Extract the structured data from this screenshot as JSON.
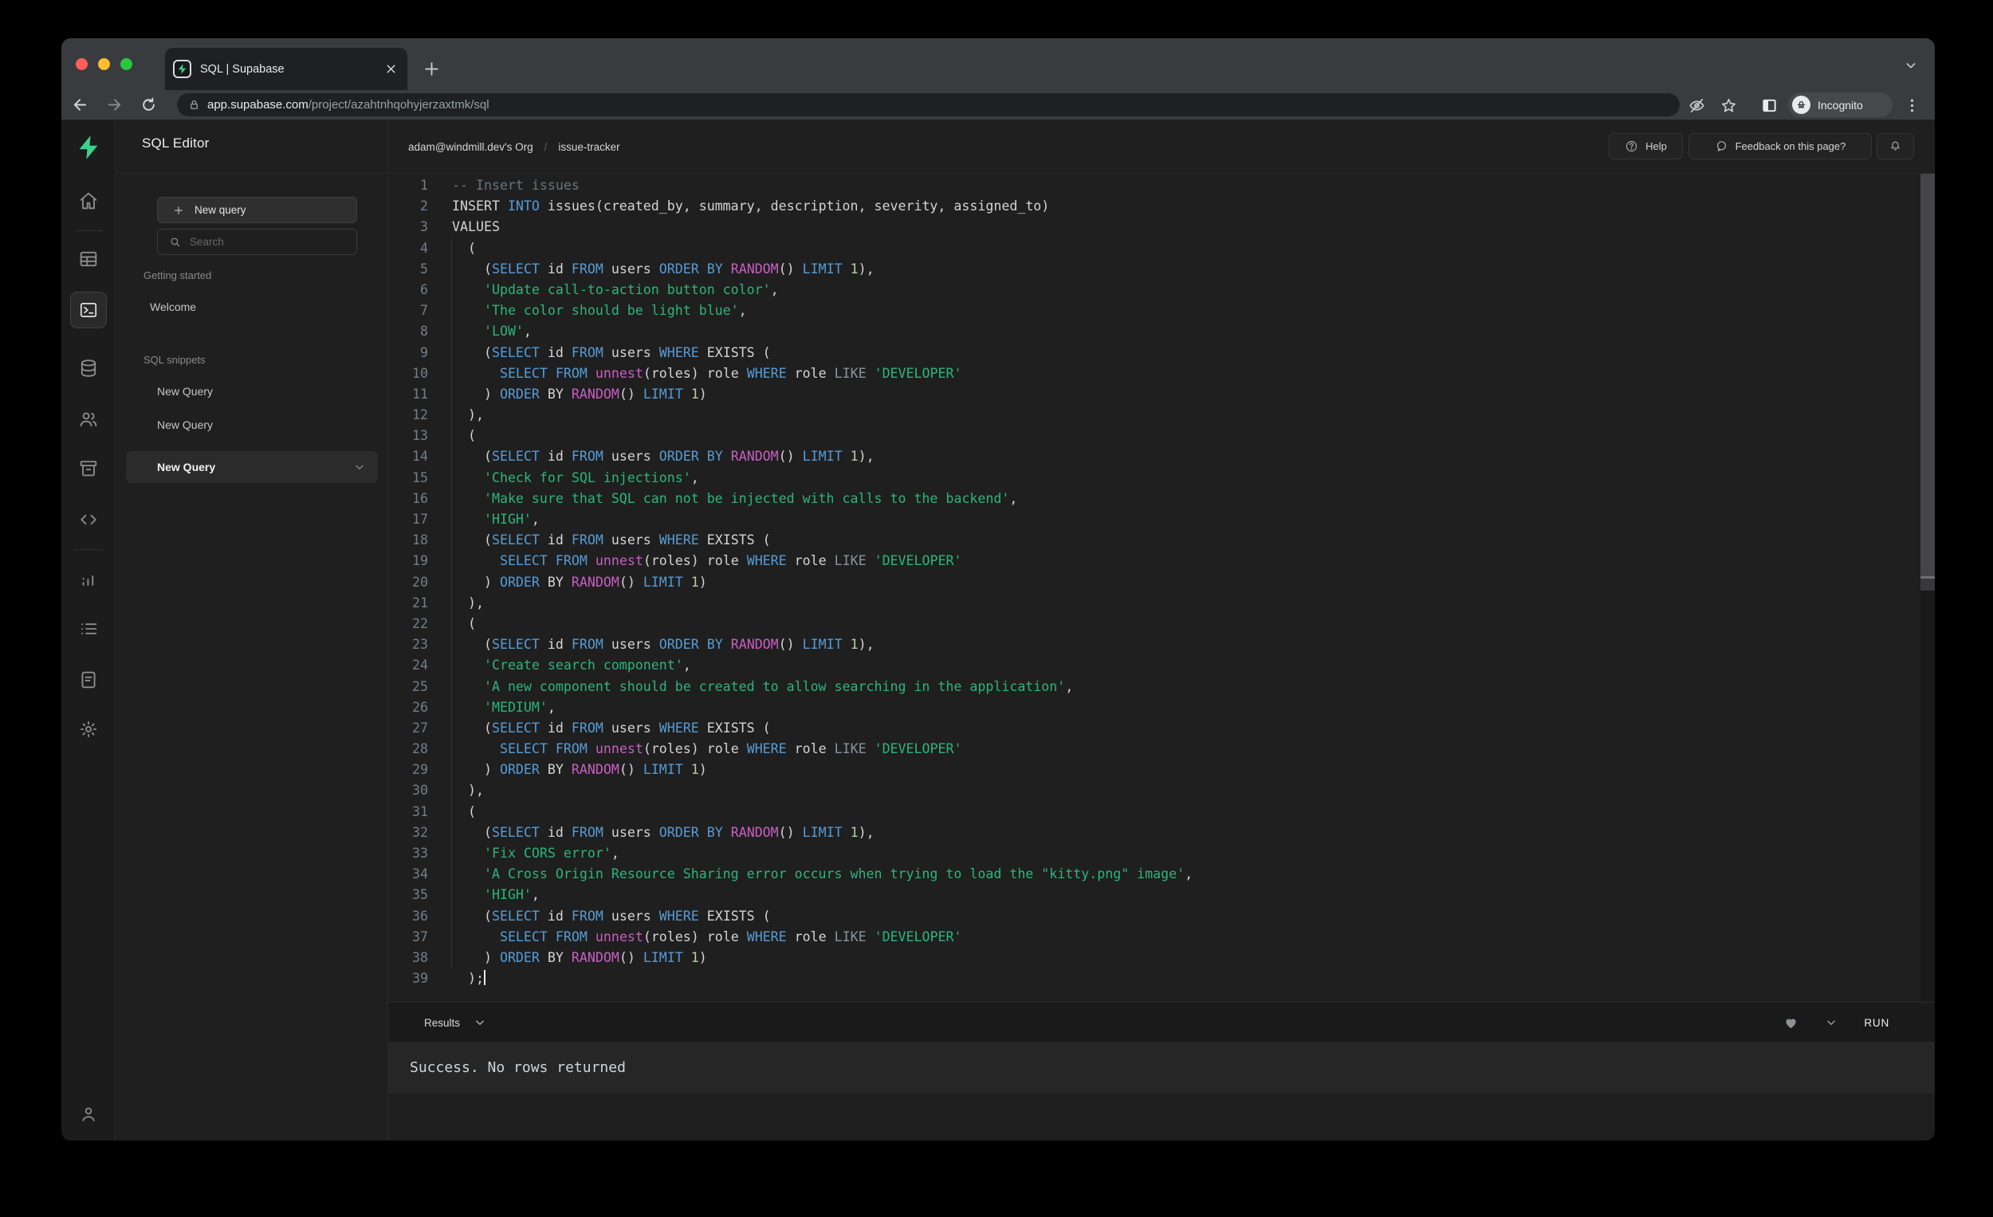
{
  "chrome": {
    "tab_title": "SQL | Supabase",
    "url_host": "app.supabase.com",
    "url_path": "/project/azahtnhqohyjerzaxtmk/sql",
    "incognito_label": "Incognito"
  },
  "rail_items": [
    {
      "icon": "supabase-logo-icon",
      "type": "logo"
    },
    {
      "icon": "home-icon"
    },
    {
      "type": "divider"
    },
    {
      "icon": "table-editor-icon"
    },
    {
      "icon": "sql-editor-icon",
      "selected": true
    },
    {
      "icon": "database-icon"
    },
    {
      "icon": "auth-icon"
    },
    {
      "icon": "storage-icon"
    },
    {
      "icon": "code-icon"
    },
    {
      "type": "divider"
    },
    {
      "icon": "reports-icon"
    },
    {
      "icon": "logs-icon"
    },
    {
      "icon": "docs-icon"
    },
    {
      "icon": "settings-icon"
    },
    {
      "icon": "profile-icon"
    }
  ],
  "sidebar": {
    "title": "SQL Editor",
    "new_query_button": "New query",
    "search_placeholder": "Search",
    "sections": [
      {
        "label": "Getting started",
        "items": [
          {
            "label": "Welcome",
            "style": "welcome"
          }
        ]
      },
      {
        "label": "SQL snippets",
        "items": [
          {
            "label": "New Query"
          },
          {
            "label": "New Query"
          },
          {
            "label": "New Query",
            "selected": true
          }
        ]
      }
    ]
  },
  "header": {
    "org": "adam@windmill.dev's Org",
    "separator": "/",
    "project": "issue-tracker",
    "help_label": "Help",
    "feedback_label": "Feedback on this page?"
  },
  "editor": {
    "syntax_colors": {
      "d": "#D4D4D4",
      "k": "#569CD6",
      "f": "#C95FC3",
      "s": "#2DB47E",
      "c": "#6A737D",
      "n": "#B5CEA8",
      "g": "#8B939E"
    },
    "lines": [
      {
        "segs": [
          [
            "c",
            "-- Insert issues"
          ]
        ]
      },
      {
        "segs": [
          [
            "d",
            "INSERT "
          ],
          [
            "k",
            "INTO"
          ],
          [
            "d",
            " issues(created_by, summary, description, severity, assigned_to)"
          ]
        ]
      },
      {
        "segs": [
          [
            "d",
            "VALUES"
          ]
        ]
      },
      {
        "segs": [
          [
            "d",
            "  ("
          ]
        ]
      },
      {
        "segs": [
          [
            "d",
            "    ("
          ],
          [
            "k",
            "SELECT"
          ],
          [
            "d",
            " id "
          ],
          [
            "k",
            "FROM"
          ],
          [
            "d",
            " users "
          ],
          [
            "k",
            "ORDER"
          ],
          [
            "d",
            " "
          ],
          [
            "k",
            "BY"
          ],
          [
            "d",
            " "
          ],
          [
            "f",
            "RANDOM"
          ],
          [
            "d",
            "() "
          ],
          [
            "k",
            "LIMIT"
          ],
          [
            "d",
            " "
          ],
          [
            "n",
            "1"
          ],
          [
            "d",
            "),"
          ]
        ]
      },
      {
        "segs": [
          [
            "d",
            "    "
          ],
          [
            "s",
            "'Update call-to-action button color'"
          ],
          [
            "d",
            ","
          ]
        ]
      },
      {
        "segs": [
          [
            "d",
            "    "
          ],
          [
            "s",
            "'The color should be light blue'"
          ],
          [
            "d",
            ","
          ]
        ]
      },
      {
        "segs": [
          [
            "d",
            "    "
          ],
          [
            "s",
            "'LOW'"
          ],
          [
            "d",
            ","
          ]
        ]
      },
      {
        "segs": [
          [
            "d",
            "    ("
          ],
          [
            "k",
            "SELECT"
          ],
          [
            "d",
            " id "
          ],
          [
            "k",
            "FROM"
          ],
          [
            "d",
            " users "
          ],
          [
            "k",
            "WHERE"
          ],
          [
            "d",
            " EXISTS ("
          ]
        ]
      },
      {
        "segs": [
          [
            "d",
            "      "
          ],
          [
            "k",
            "SELECT"
          ],
          [
            "d",
            " "
          ],
          [
            "k",
            "FROM"
          ],
          [
            "d",
            " "
          ],
          [
            "f",
            "unnest"
          ],
          [
            "d",
            "(roles) role "
          ],
          [
            "k",
            "WHERE"
          ],
          [
            "d",
            " role "
          ],
          [
            "g",
            "LIKE"
          ],
          [
            "d",
            " "
          ],
          [
            "s",
            "'DEVELOPER'"
          ]
        ]
      },
      {
        "segs": [
          [
            "d",
            "    ) "
          ],
          [
            "k",
            "ORDER"
          ],
          [
            "d",
            " BY "
          ],
          [
            "f",
            "RANDOM"
          ],
          [
            "d",
            "() "
          ],
          [
            "k",
            "LIMIT"
          ],
          [
            "d",
            " "
          ],
          [
            "n",
            "1"
          ],
          [
            "d",
            ")"
          ]
        ]
      },
      {
        "segs": [
          [
            "d",
            "  ),"
          ]
        ]
      },
      {
        "segs": [
          [
            "d",
            "  ("
          ]
        ]
      },
      {
        "segs": [
          [
            "d",
            "    ("
          ],
          [
            "k",
            "SELECT"
          ],
          [
            "d",
            " id "
          ],
          [
            "k",
            "FROM"
          ],
          [
            "d",
            " users "
          ],
          [
            "k",
            "ORDER"
          ],
          [
            "d",
            " "
          ],
          [
            "k",
            "BY"
          ],
          [
            "d",
            " "
          ],
          [
            "f",
            "RANDOM"
          ],
          [
            "d",
            "() "
          ],
          [
            "k",
            "LIMIT"
          ],
          [
            "d",
            " "
          ],
          [
            "n",
            "1"
          ],
          [
            "d",
            "),"
          ]
        ]
      },
      {
        "segs": [
          [
            "d",
            "    "
          ],
          [
            "s",
            "'Check for SQL injections'"
          ],
          [
            "d",
            ","
          ]
        ]
      },
      {
        "segs": [
          [
            "d",
            "    "
          ],
          [
            "s",
            "'Make sure that SQL can not be injected with calls to the backend'"
          ],
          [
            "d",
            ","
          ]
        ]
      },
      {
        "segs": [
          [
            "d",
            "    "
          ],
          [
            "s",
            "'HIGH'"
          ],
          [
            "d",
            ","
          ]
        ]
      },
      {
        "segs": [
          [
            "d",
            "    ("
          ],
          [
            "k",
            "SELECT"
          ],
          [
            "d",
            " id "
          ],
          [
            "k",
            "FROM"
          ],
          [
            "d",
            " users "
          ],
          [
            "k",
            "WHERE"
          ],
          [
            "d",
            " EXISTS ("
          ]
        ]
      },
      {
        "segs": [
          [
            "d",
            "      "
          ],
          [
            "k",
            "SELECT"
          ],
          [
            "d",
            " "
          ],
          [
            "k",
            "FROM"
          ],
          [
            "d",
            " "
          ],
          [
            "f",
            "unnest"
          ],
          [
            "d",
            "(roles) role "
          ],
          [
            "k",
            "WHERE"
          ],
          [
            "d",
            " role "
          ],
          [
            "g",
            "LIKE"
          ],
          [
            "d",
            " "
          ],
          [
            "s",
            "'DEVELOPER'"
          ]
        ]
      },
      {
        "segs": [
          [
            "d",
            "    ) "
          ],
          [
            "k",
            "ORDER"
          ],
          [
            "d",
            " BY "
          ],
          [
            "f",
            "RANDOM"
          ],
          [
            "d",
            "() "
          ],
          [
            "k",
            "LIMIT"
          ],
          [
            "d",
            " "
          ],
          [
            "n",
            "1"
          ],
          [
            "d",
            ")"
          ]
        ]
      },
      {
        "segs": [
          [
            "d",
            "  ),"
          ]
        ]
      },
      {
        "segs": [
          [
            "d",
            "  ("
          ]
        ]
      },
      {
        "segs": [
          [
            "d",
            "    ("
          ],
          [
            "k",
            "SELECT"
          ],
          [
            "d",
            " id "
          ],
          [
            "k",
            "FROM"
          ],
          [
            "d",
            " users "
          ],
          [
            "k",
            "ORDER"
          ],
          [
            "d",
            " "
          ],
          [
            "k",
            "BY"
          ],
          [
            "d",
            " "
          ],
          [
            "f",
            "RANDOM"
          ],
          [
            "d",
            "() "
          ],
          [
            "k",
            "LIMIT"
          ],
          [
            "d",
            " "
          ],
          [
            "n",
            "1"
          ],
          [
            "d",
            "),"
          ]
        ]
      },
      {
        "segs": [
          [
            "d",
            "    "
          ],
          [
            "s",
            "'Create search component'"
          ],
          [
            "d",
            ","
          ]
        ]
      },
      {
        "segs": [
          [
            "d",
            "    "
          ],
          [
            "s",
            "'A new component should be created to allow searching in the application'"
          ],
          [
            "d",
            ","
          ]
        ]
      },
      {
        "segs": [
          [
            "d",
            "    "
          ],
          [
            "s",
            "'MEDIUM'"
          ],
          [
            "d",
            ","
          ]
        ]
      },
      {
        "segs": [
          [
            "d",
            "    ("
          ],
          [
            "k",
            "SELECT"
          ],
          [
            "d",
            " id "
          ],
          [
            "k",
            "FROM"
          ],
          [
            "d",
            " users "
          ],
          [
            "k",
            "WHERE"
          ],
          [
            "d",
            " EXISTS ("
          ]
        ]
      },
      {
        "segs": [
          [
            "d",
            "      "
          ],
          [
            "k",
            "SELECT"
          ],
          [
            "d",
            " "
          ],
          [
            "k",
            "FROM"
          ],
          [
            "d",
            " "
          ],
          [
            "f",
            "unnest"
          ],
          [
            "d",
            "(roles) role "
          ],
          [
            "k",
            "WHERE"
          ],
          [
            "d",
            " role "
          ],
          [
            "g",
            "LIKE"
          ],
          [
            "d",
            " "
          ],
          [
            "s",
            "'DEVELOPER'"
          ]
        ]
      },
      {
        "segs": [
          [
            "d",
            "    ) "
          ],
          [
            "k",
            "ORDER"
          ],
          [
            "d",
            " BY "
          ],
          [
            "f",
            "RANDOM"
          ],
          [
            "d",
            "() "
          ],
          [
            "k",
            "LIMIT"
          ],
          [
            "d",
            " "
          ],
          [
            "n",
            "1"
          ],
          [
            "d",
            ")"
          ]
        ]
      },
      {
        "segs": [
          [
            "d",
            "  ),"
          ]
        ]
      },
      {
        "segs": [
          [
            "d",
            "  ("
          ]
        ]
      },
      {
        "segs": [
          [
            "d",
            "    ("
          ],
          [
            "k",
            "SELECT"
          ],
          [
            "d",
            " id "
          ],
          [
            "k",
            "FROM"
          ],
          [
            "d",
            " users "
          ],
          [
            "k",
            "ORDER"
          ],
          [
            "d",
            " "
          ],
          [
            "k",
            "BY"
          ],
          [
            "d",
            " "
          ],
          [
            "f",
            "RANDOM"
          ],
          [
            "d",
            "() "
          ],
          [
            "k",
            "LIMIT"
          ],
          [
            "d",
            " "
          ],
          [
            "n",
            "1"
          ],
          [
            "d",
            "),"
          ]
        ]
      },
      {
        "segs": [
          [
            "d",
            "    "
          ],
          [
            "s",
            "'Fix CORS error'"
          ],
          [
            "d",
            ","
          ]
        ]
      },
      {
        "segs": [
          [
            "d",
            "    "
          ],
          [
            "s",
            "'A Cross Origin Resource Sharing error occurs when trying to load the \"kitty.png\" image'"
          ],
          [
            "d",
            ","
          ]
        ]
      },
      {
        "segs": [
          [
            "d",
            "    "
          ],
          [
            "s",
            "'HIGH'"
          ],
          [
            "d",
            ","
          ]
        ]
      },
      {
        "segs": [
          [
            "d",
            "    ("
          ],
          [
            "k",
            "SELECT"
          ],
          [
            "d",
            " id "
          ],
          [
            "k",
            "FROM"
          ],
          [
            "d",
            " users "
          ],
          [
            "k",
            "WHERE"
          ],
          [
            "d",
            " EXISTS ("
          ]
        ]
      },
      {
        "segs": [
          [
            "d",
            "      "
          ],
          [
            "k",
            "SELECT"
          ],
          [
            "d",
            " "
          ],
          [
            "k",
            "FROM"
          ],
          [
            "d",
            " "
          ],
          [
            "f",
            "unnest"
          ],
          [
            "d",
            "(roles) role "
          ],
          [
            "k",
            "WHERE"
          ],
          [
            "d",
            " role "
          ],
          [
            "g",
            "LIKE"
          ],
          [
            "d",
            " "
          ],
          [
            "s",
            "'DEVELOPER'"
          ]
        ]
      },
      {
        "segs": [
          [
            "d",
            "    ) "
          ],
          [
            "k",
            "ORDER"
          ],
          [
            "d",
            " BY "
          ],
          [
            "f",
            "RANDOM"
          ],
          [
            "d",
            "() "
          ],
          [
            "k",
            "LIMIT"
          ],
          [
            "d",
            " "
          ],
          [
            "n",
            "1"
          ],
          [
            "d",
            ")"
          ]
        ]
      },
      {
        "segs": [
          [
            "d",
            "  );"
          ]
        ],
        "cursor": true
      }
    ]
  },
  "results": {
    "label": "Results",
    "run_label": "RUN",
    "message": "Success. No rows returned"
  },
  "colors": {
    "accent": "#3ECF8E"
  }
}
